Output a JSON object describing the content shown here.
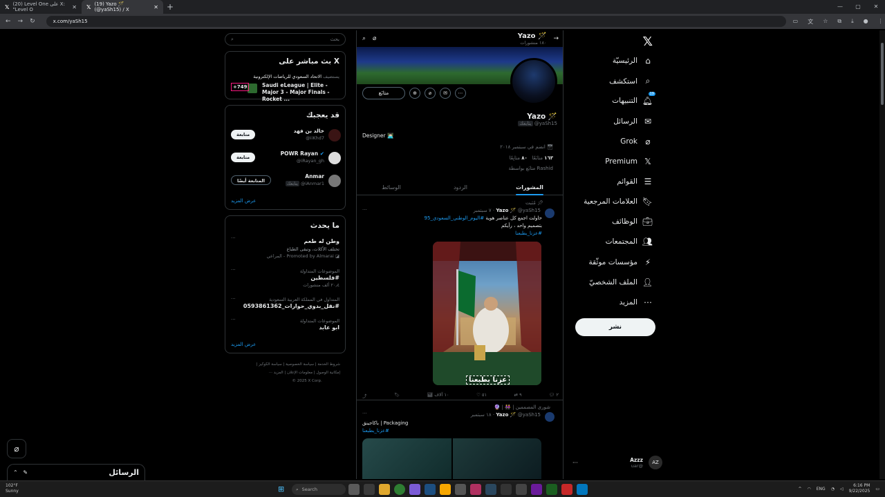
{
  "browser": {
    "tabs": [
      {
        "title": "(20) Level One على X: \"Level O"
      },
      {
        "title": "(19) Yazo 🪄 (@yaSh15) / X"
      }
    ],
    "url": "x.com/yaSh15"
  },
  "nav": {
    "items": [
      {
        "label": "الرئيسيّة",
        "icon": "home-icon",
        "glyph": "⌂"
      },
      {
        "label": "استكشف",
        "icon": "search-icon",
        "glyph": "⌕"
      },
      {
        "label": "التنبيهات",
        "icon": "bell-icon",
        "glyph": "🔔︎",
        "badge": "19"
      },
      {
        "label": "الرسائل",
        "icon": "mail-icon",
        "glyph": "✉"
      },
      {
        "label": "Grok",
        "icon": "grok-icon",
        "glyph": "⌀"
      },
      {
        "label": "Premium",
        "icon": "x-logo-icon",
        "glyph": "𝕏"
      },
      {
        "label": "القوائم",
        "icon": "list-icon",
        "glyph": "☰"
      },
      {
        "label": "العلامات المرجعية",
        "icon": "bookmark-icon",
        "glyph": "🔖︎"
      },
      {
        "label": "الوظائف",
        "icon": "briefcase-icon",
        "glyph": "💼︎"
      },
      {
        "label": "المجتمعات",
        "icon": "communities-icon",
        "glyph": "👥︎"
      },
      {
        "label": "مؤسسات موثّقة",
        "icon": "lightning-icon",
        "glyph": "⚡︎"
      },
      {
        "label": "الملف الشخصيّ",
        "icon": "person-icon",
        "glyph": "👤︎"
      },
      {
        "label": "المزيد",
        "icon": "more-circle-icon",
        "glyph": "⋯"
      }
    ],
    "post_label": "نشر",
    "account": {
      "name": "Azzz",
      "handle": "@uar",
      "initials": "AZ"
    }
  },
  "profile": {
    "header_name": "Yazo 🪄",
    "header_posts": "١٨٠ منشورات",
    "follow_label": "متابَع",
    "name": "Yazo 🪄",
    "handle": "@yaSh15",
    "handle_tag": "يتابعك",
    "bio": "Designer 👨🏻‍💻",
    "joined": "انضم في سبتمبر ٢٠١٨",
    "following_count": "١٦٣",
    "following_label": "متابَعًا",
    "followers_count": "٨٠",
    "followers_label": "متابِعًا",
    "followed_by": "Rashid متابَع بواسطة",
    "tabs": [
      "المشورات",
      "الردود",
      "الوسائط"
    ]
  },
  "tweets": [
    {
      "pinned": "مُثبت",
      "name": "Yazo 🪄",
      "handle": "@yaSh15",
      "date": "٧ سبتمبر",
      "text_line1": "حاولت اجمع كل عناصر هوية",
      "hashtag1": "#اليوم_الوطني_السعودي_95",
      "text_line2": "بتصميم واحد ، رأيكم",
      "hashtag2": "#عزنا_بطبعنا",
      "image_caption": "عزنا بطبعنا",
      "actions": {
        "replies": "٢",
        "retweets": "٩",
        "likes": "٥١",
        "views": "١٠ آلاف"
      }
    },
    {
      "community": "شورى المصممين | 👭 | 🔮",
      "name": "Yazo 🪄",
      "handle": "@yaSh15",
      "date": "١٨ سبتمبر",
      "text": "باكاجينق | Packaging",
      "hashtag": "#عزنا_بطبعنا"
    }
  ],
  "right": {
    "search_placeholder": "بحث",
    "live": {
      "title": "X بث مباشر على",
      "host": "الاتحاد السعودي للرياضات الإلكترونية",
      "host_tag": "يستضيف",
      "event": "Saudi eLeague | Elite - Major 3 - Major Finals - Rocket ...",
      "count": "+749"
    },
    "who_to_follow": {
      "title": "قد يعجبك",
      "users": [
        {
          "name": "خالد بن فهد",
          "handle": "@iiKhd7",
          "button": "متابعة"
        },
        {
          "name": "POWR Rayan",
          "handle": "@iRayan_gh",
          "button": "متابعة"
        },
        {
          "name": "Anmar",
          "handle": "@iAnmar1",
          "handle_tag": "يتابعك",
          "button": "المتابعة أيضًا"
        }
      ],
      "more": "عرض المزيد"
    },
    "trends": {
      "title": "ما يحدث",
      "items": [
        {
          "title": "وطن له طعم",
          "desc": "تختلف الأكلات، وتبقى الطباع",
          "meta": "Promoted by Almarai - المراعي"
        },
        {
          "context": "الموضوعات المتداولة",
          "title": "#فلسطين",
          "meta": "٢٠٫٤ ألف منشورات"
        },
        {
          "context": "المتداول في المملكة العربية السعودية",
          "title": "#نقل_بدوي_حوارات_0593861362"
        },
        {
          "context": "الموضوعات المتداولة",
          "title": "ابو عابد"
        }
      ],
      "more": "عرض المزيد"
    },
    "footer": {
      "line1": "شروط الخدمة | سياسة الخصوصية | سياسة الكوكيز |",
      "line2": "إمكانية الوصول | معلومات الإعلان | المزيد ···",
      "line3": "© 2025 X Corp."
    }
  },
  "messages_drawer": {
    "label": "الرسائل"
  },
  "taskbar": {
    "weather_temp": "102°F",
    "weather_desc": "Sunny",
    "search": "Search",
    "lang": "ENG",
    "time": "6:16 PM",
    "date": "9/22/2025"
  },
  "colors": {
    "accent": "#1d9bf0",
    "bg": "#000000",
    "text": "#e7e9ea",
    "muted": "#71767b",
    "border": "#2f3336"
  }
}
